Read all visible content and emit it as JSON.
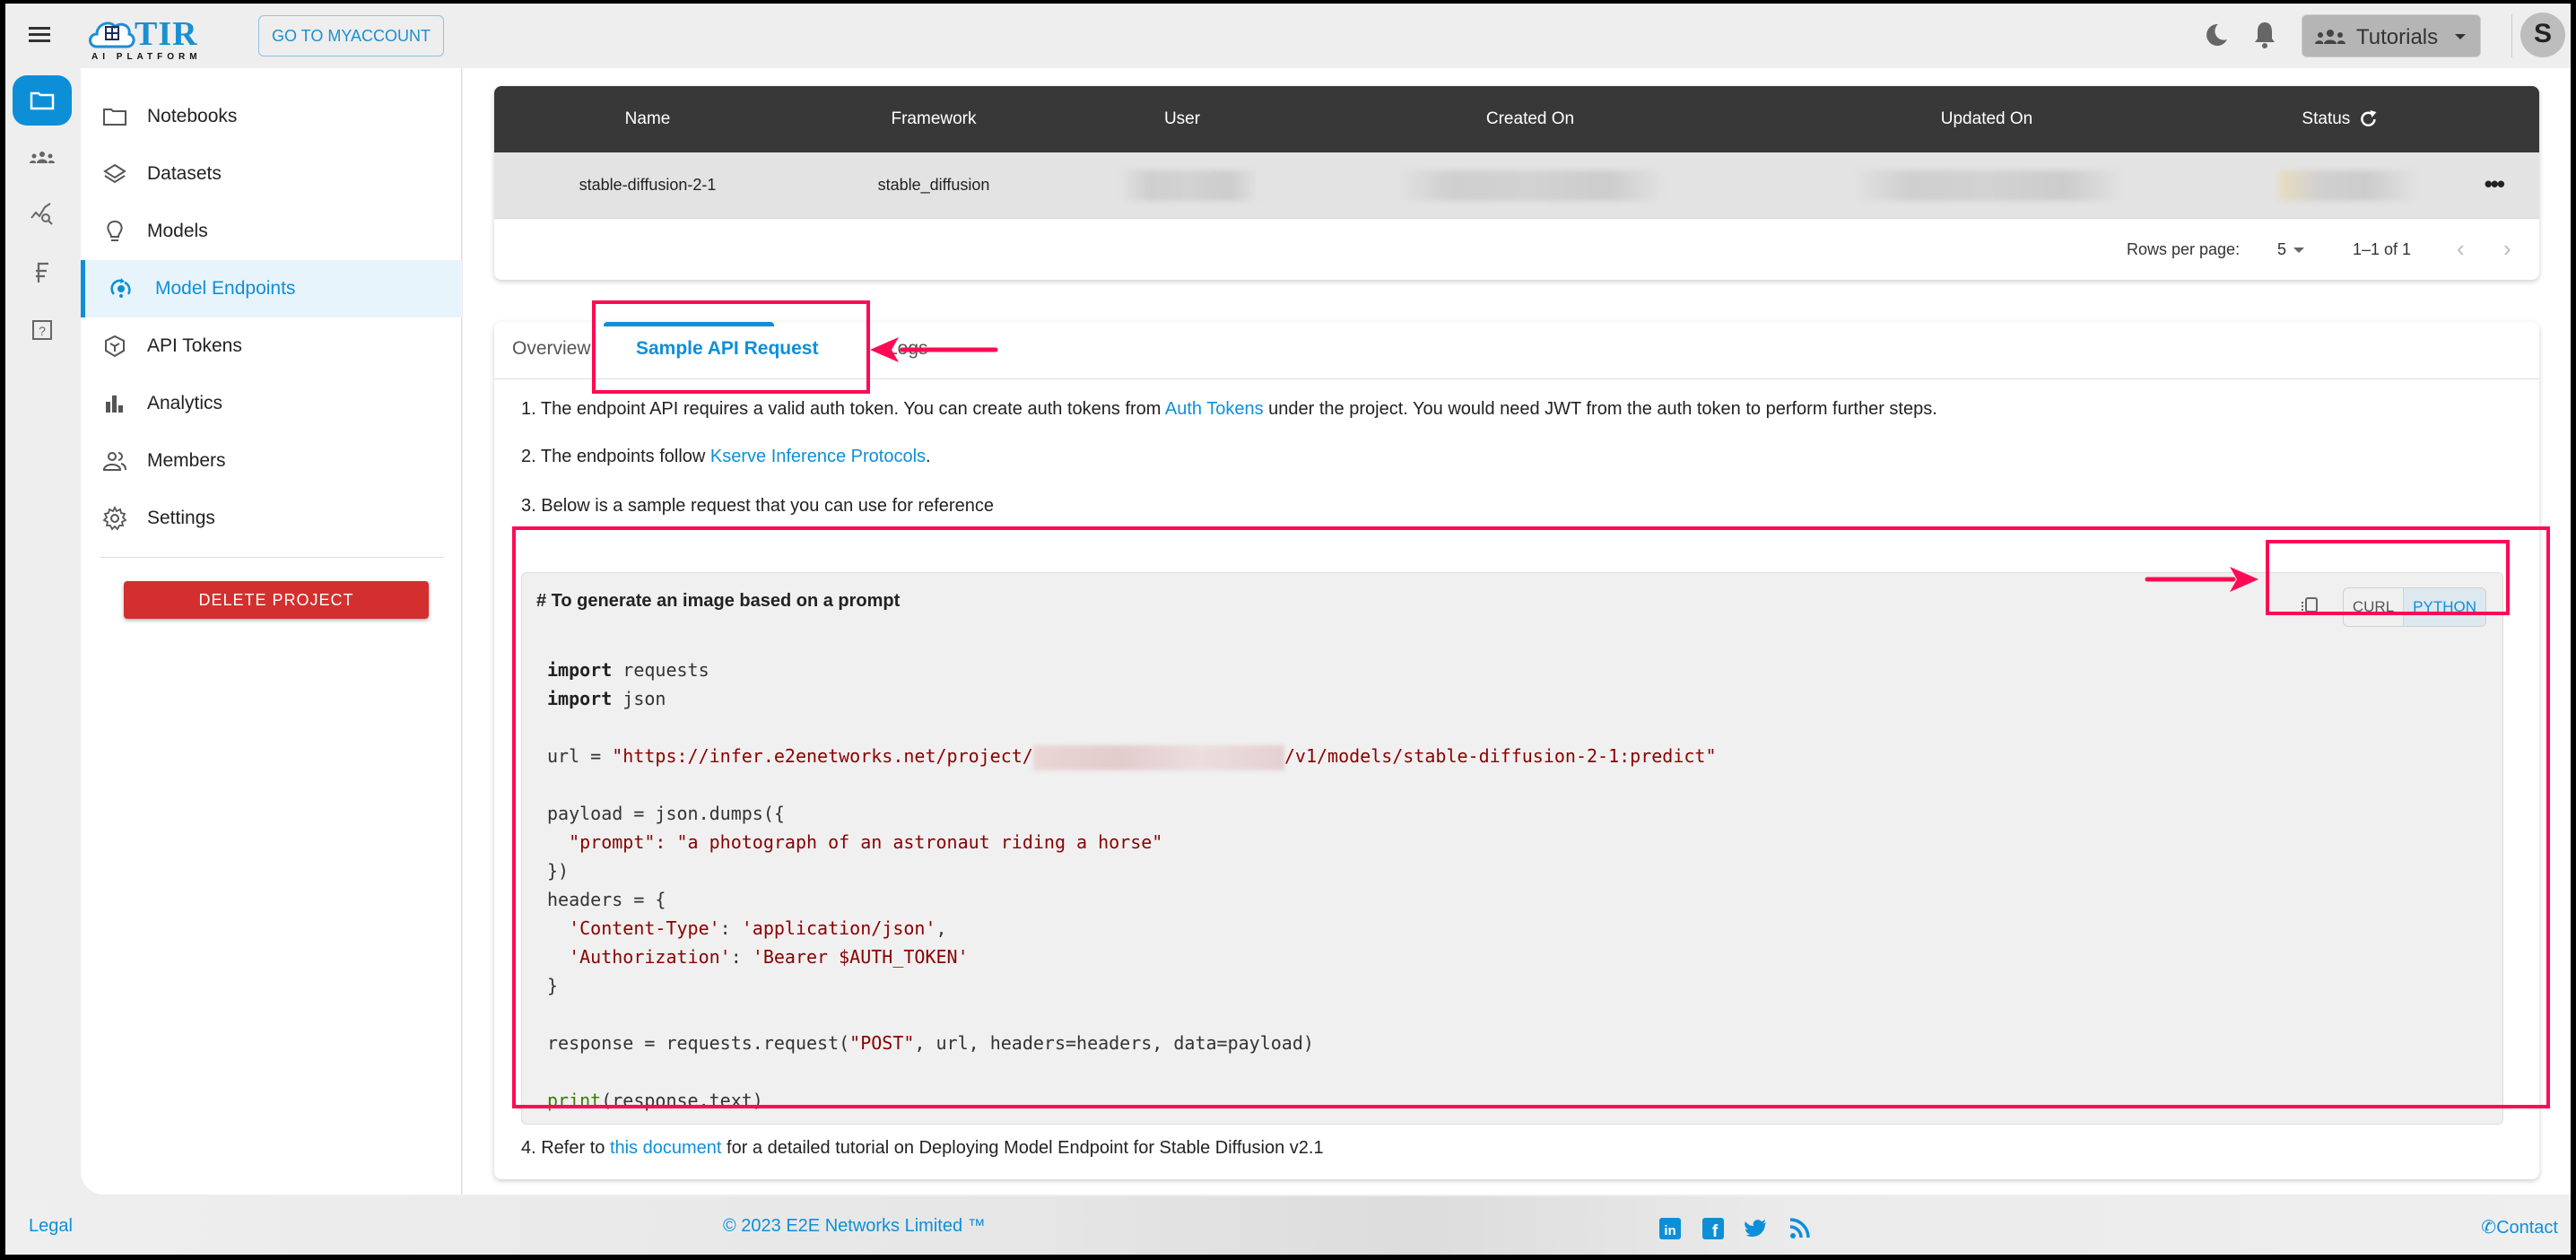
{
  "header": {
    "menu_icon": "hamburger-menu-icon",
    "logo": {
      "title": "TIR",
      "subtitle": "AI PLATFORM",
      "badge": "E2E Cloud"
    },
    "go_to_myaccount": "GO TO MYACCOUNT",
    "theme_icon": "moon-icon",
    "notifications_icon": "bell-icon",
    "project_selector": {
      "icon": "people-group-icon",
      "value": "Tutorials"
    },
    "avatar_initial": "S"
  },
  "rail": {
    "items": [
      {
        "name": "projects",
        "icon": "folder-icon",
        "active": true
      },
      {
        "name": "teams",
        "icon": "people-group-icon"
      },
      {
        "name": "monitoring",
        "icon": "chart-search-icon"
      },
      {
        "name": "billing",
        "icon": "currency-icon"
      },
      {
        "name": "help",
        "icon": "help-box-icon"
      }
    ]
  },
  "sidebar": {
    "items": [
      {
        "label": "Notebooks",
        "icon": "folder-icon"
      },
      {
        "label": "Datasets",
        "icon": "layers-icon"
      },
      {
        "label": "Models",
        "icon": "lightbulb-icon"
      },
      {
        "label": "Model Endpoints",
        "icon": "endpoint-icon",
        "active": true
      },
      {
        "label": "API Tokens",
        "icon": "cube-icon"
      },
      {
        "label": "Analytics",
        "icon": "bar-chart-icon"
      },
      {
        "label": "Members",
        "icon": "members-icon"
      },
      {
        "label": "Settings",
        "icon": "gear-icon"
      }
    ],
    "delete_project": "DELETE PROJECT"
  },
  "endpoints_table": {
    "columns": [
      "Name",
      "Framework",
      "User",
      "Created On",
      "Updated On",
      "Status"
    ],
    "rows": [
      {
        "name": "stable-diffusion-2-1",
        "framework": "stable_diffusion",
        "user": "[blurred]",
        "created_on": "[blurred]",
        "updated_on": "[blurred]",
        "status": "[blurred]"
      }
    ],
    "more_actions_icon": "more-horizontal-icon",
    "status_refresh_icon": "refresh-icon",
    "pagination": {
      "rows_per_page_label": "Rows per page:",
      "rows_per_page_value": "5",
      "range": "1–1 of 1"
    }
  },
  "detail": {
    "tabs": [
      {
        "label": "Overview"
      },
      {
        "label": "Sample API Request",
        "active": true
      },
      {
        "label": "Logs"
      }
    ],
    "instructions": {
      "step1_prefix": "1. The endpoint API requires a valid auth token. You can create auth tokens from ",
      "step1_link": "Auth Tokens",
      "step1_suffix": " under the project. You would need JWT from the auth token to perform further steps.",
      "step2_prefix": "2. The endpoints follow ",
      "step2_link": "Kserve Inference Protocols",
      "step2_suffix": ".",
      "step3": "3. Below is a sample request that you can use for reference",
      "step4_prefix": "4. Refer to ",
      "step4_link": "this document",
      "step4_suffix": " for a detailed tutorial on Deploying Model Endpoint for Stable Diffusion v2.1"
    },
    "code": {
      "title": "# To generate an image based on a prompt",
      "copy_icon": "copy-icon",
      "languages": [
        {
          "label": "CURL"
        },
        {
          "label": "PYTHON",
          "active": true
        }
      ],
      "lines": {
        "import1_kw": "import",
        "import1_mod": " requests",
        "import2_kw": "import",
        "import2_mod": " json",
        "url_prefix": "url = ",
        "url_start": "\"https://infer.e2enetworks.net/project/",
        "url_end": "/v1/models/stable-diffusion-2-1:predict\"",
        "payload_open": "payload = json.dumps({",
        "prompt_indent": "  ",
        "prompt_line": "\"prompt\": \"a photograph of an astronaut riding a horse\"",
        "payload_close": "})",
        "headers_open": "headers = {",
        "content_type_key": "'Content-Type'",
        "content_type_val": "'application/json'",
        "auth_key": "'Authorization'",
        "auth_val": "'Bearer $AUTH_TOKEN'",
        "headers_close": "}",
        "response_a": "response = requests.request(",
        "response_post": "\"POST\"",
        "response_b": ", url, headers=headers, data=payload)",
        "print_fn": "print",
        "print_args": "(response.text)"
      }
    }
  },
  "footer": {
    "legal": "Legal",
    "copyright": "© 2023 E2E Networks Limited ™",
    "social": [
      "linkedin-icon",
      "facebook-icon",
      "twitter-icon",
      "rss-icon"
    ],
    "contact": "Contact"
  },
  "colors": {
    "accent": "#0d8fd8",
    "danger": "#d32f2f",
    "annotation": "#ff0a54",
    "table_header": "#383838"
  }
}
